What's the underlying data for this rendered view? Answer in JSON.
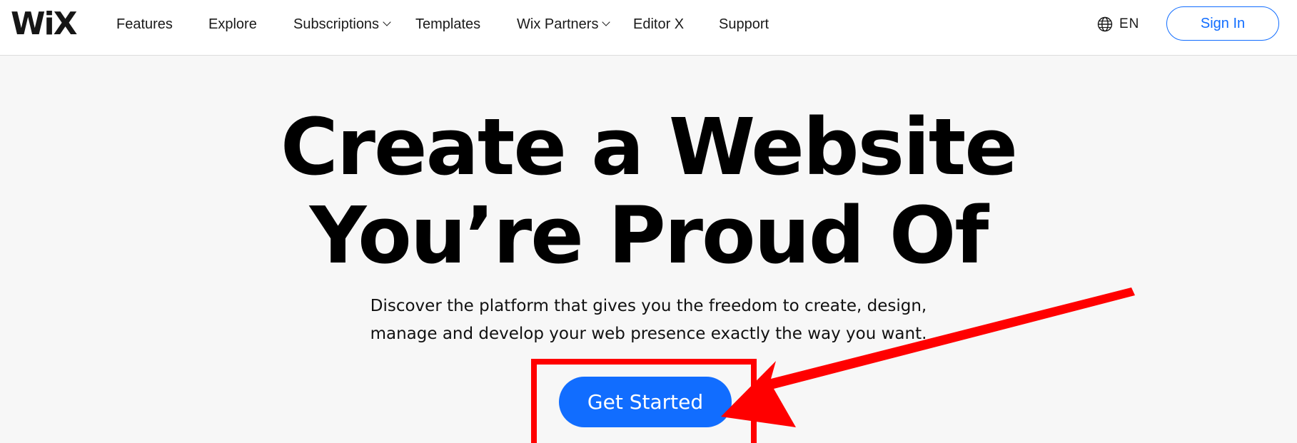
{
  "header": {
    "logo": "WiX",
    "nav": [
      {
        "label": "Features",
        "dropdown": false
      },
      {
        "label": "Explore",
        "dropdown": false
      },
      {
        "label": "Subscriptions",
        "dropdown": true
      },
      {
        "label": "Templates",
        "dropdown": false
      },
      {
        "label": "Wix Partners",
        "dropdown": true
      },
      {
        "label": "Editor X",
        "dropdown": false
      },
      {
        "label": "Support",
        "dropdown": false
      }
    ],
    "language": {
      "icon": "globe-icon",
      "label": "EN"
    },
    "sign_in_label": "Sign In"
  },
  "hero": {
    "title_line1": "Create a Website",
    "title_line2": "You’re Proud Of",
    "subtitle_line1": "Discover the platform that gives you the freedom to create, design,",
    "subtitle_line2": "manage and develop your web presence exactly the way you want.",
    "cta_label": "Get Started"
  },
  "annotation": {
    "highlight_color": "#ff0000",
    "target": "Get Started"
  },
  "colors": {
    "accent": "#116dff",
    "background": "#f7f7f7",
    "header_bg": "#ffffff"
  }
}
